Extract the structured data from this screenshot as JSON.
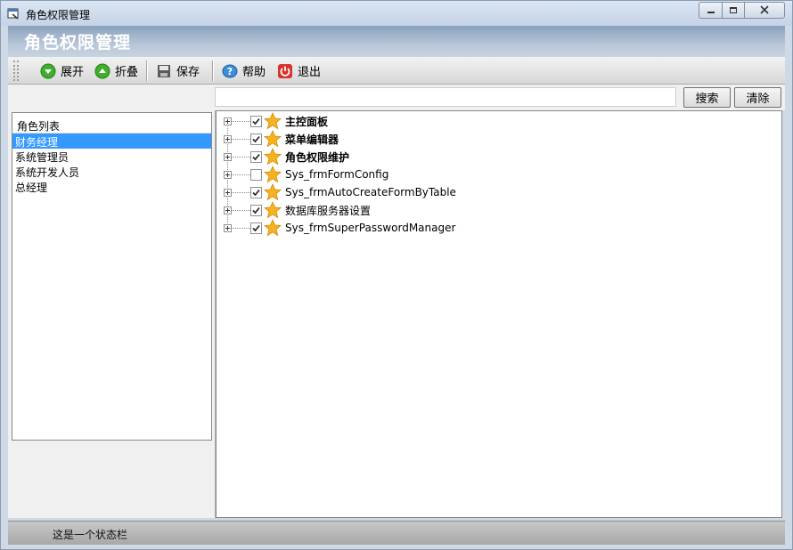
{
  "window": {
    "title": "角色权限管理",
    "banner_title": "角色权限管理"
  },
  "toolbar": {
    "expand_label": "展开",
    "collapse_label": "折叠",
    "save_label": "保存",
    "help_label": "帮助",
    "exit_label": "退出"
  },
  "search": {
    "value": "",
    "search_label": "搜索",
    "clear_label": "清除"
  },
  "roles": {
    "header": "角色列表",
    "items": [
      {
        "label": "财务经理",
        "selected": true
      },
      {
        "label": "系统管理员",
        "selected": false
      },
      {
        "label": "系统开发人员",
        "selected": false
      },
      {
        "label": "总经理",
        "selected": false
      }
    ]
  },
  "tree": {
    "nodes": [
      {
        "label": "主控面板",
        "checked": true,
        "bold": true
      },
      {
        "label": "菜单编辑器",
        "checked": true,
        "bold": true
      },
      {
        "label": "角色权限维护",
        "checked": true,
        "bold": true
      },
      {
        "label": "Sys_frmFormConfig",
        "checked": false,
        "bold": false
      },
      {
        "label": "Sys_frmAutoCreateFormByTable",
        "checked": true,
        "bold": false
      },
      {
        "label": "数据库服务器设置",
        "checked": true,
        "bold": false
      },
      {
        "label": "Sys_frmSuperPasswordManager",
        "checked": true,
        "bold": false
      }
    ]
  },
  "status": {
    "text": "这是一个状态栏"
  },
  "colors": {
    "selection": "#3399ff",
    "banner": "#8aa1bd",
    "close_red": "#c8322a"
  }
}
